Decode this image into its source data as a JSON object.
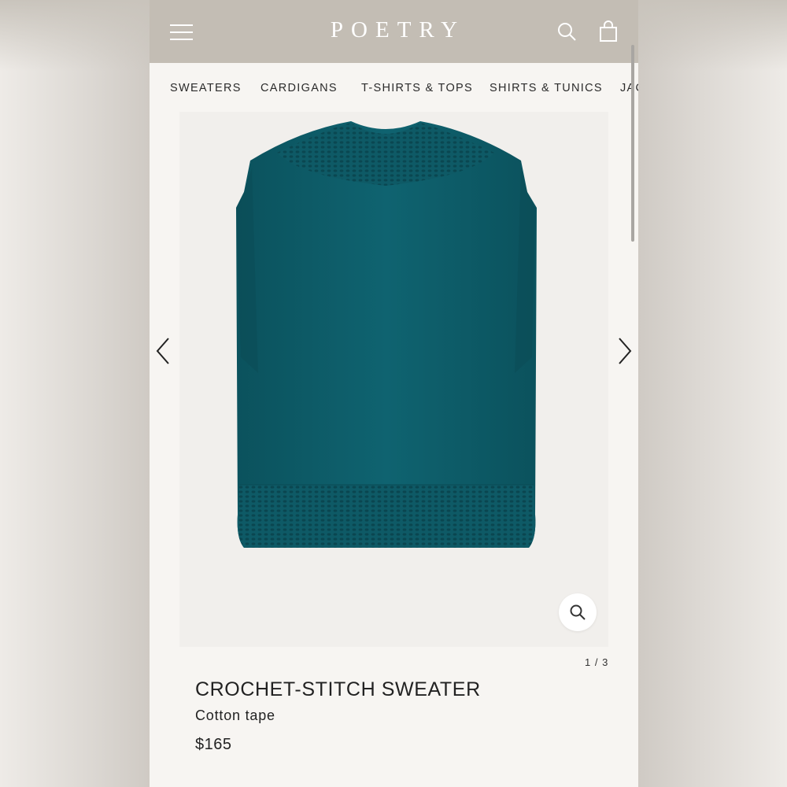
{
  "header": {
    "logo": "POETRY",
    "menu_icon": "hamburger-menu-icon",
    "search_icon": "search-icon",
    "bag_icon": "shopping-bag-icon",
    "background_color": "#c3bdb4"
  },
  "categories": [
    "SWEATERS",
    "CARDIGANS",
    "T-SHIRTS & TOPS",
    "SHIRTS & TUNICS",
    "JAC"
  ],
  "gallery": {
    "prev_icon": "chevron-left-icon",
    "next_icon": "chevron-right-icon",
    "zoom_icon": "magnifier-icon",
    "product_color": "#0f5f6b",
    "pager": "1 / 3"
  },
  "product": {
    "name": "CROCHET-STITCH SWEATER",
    "material": "Cotton tape",
    "price": "$165"
  }
}
